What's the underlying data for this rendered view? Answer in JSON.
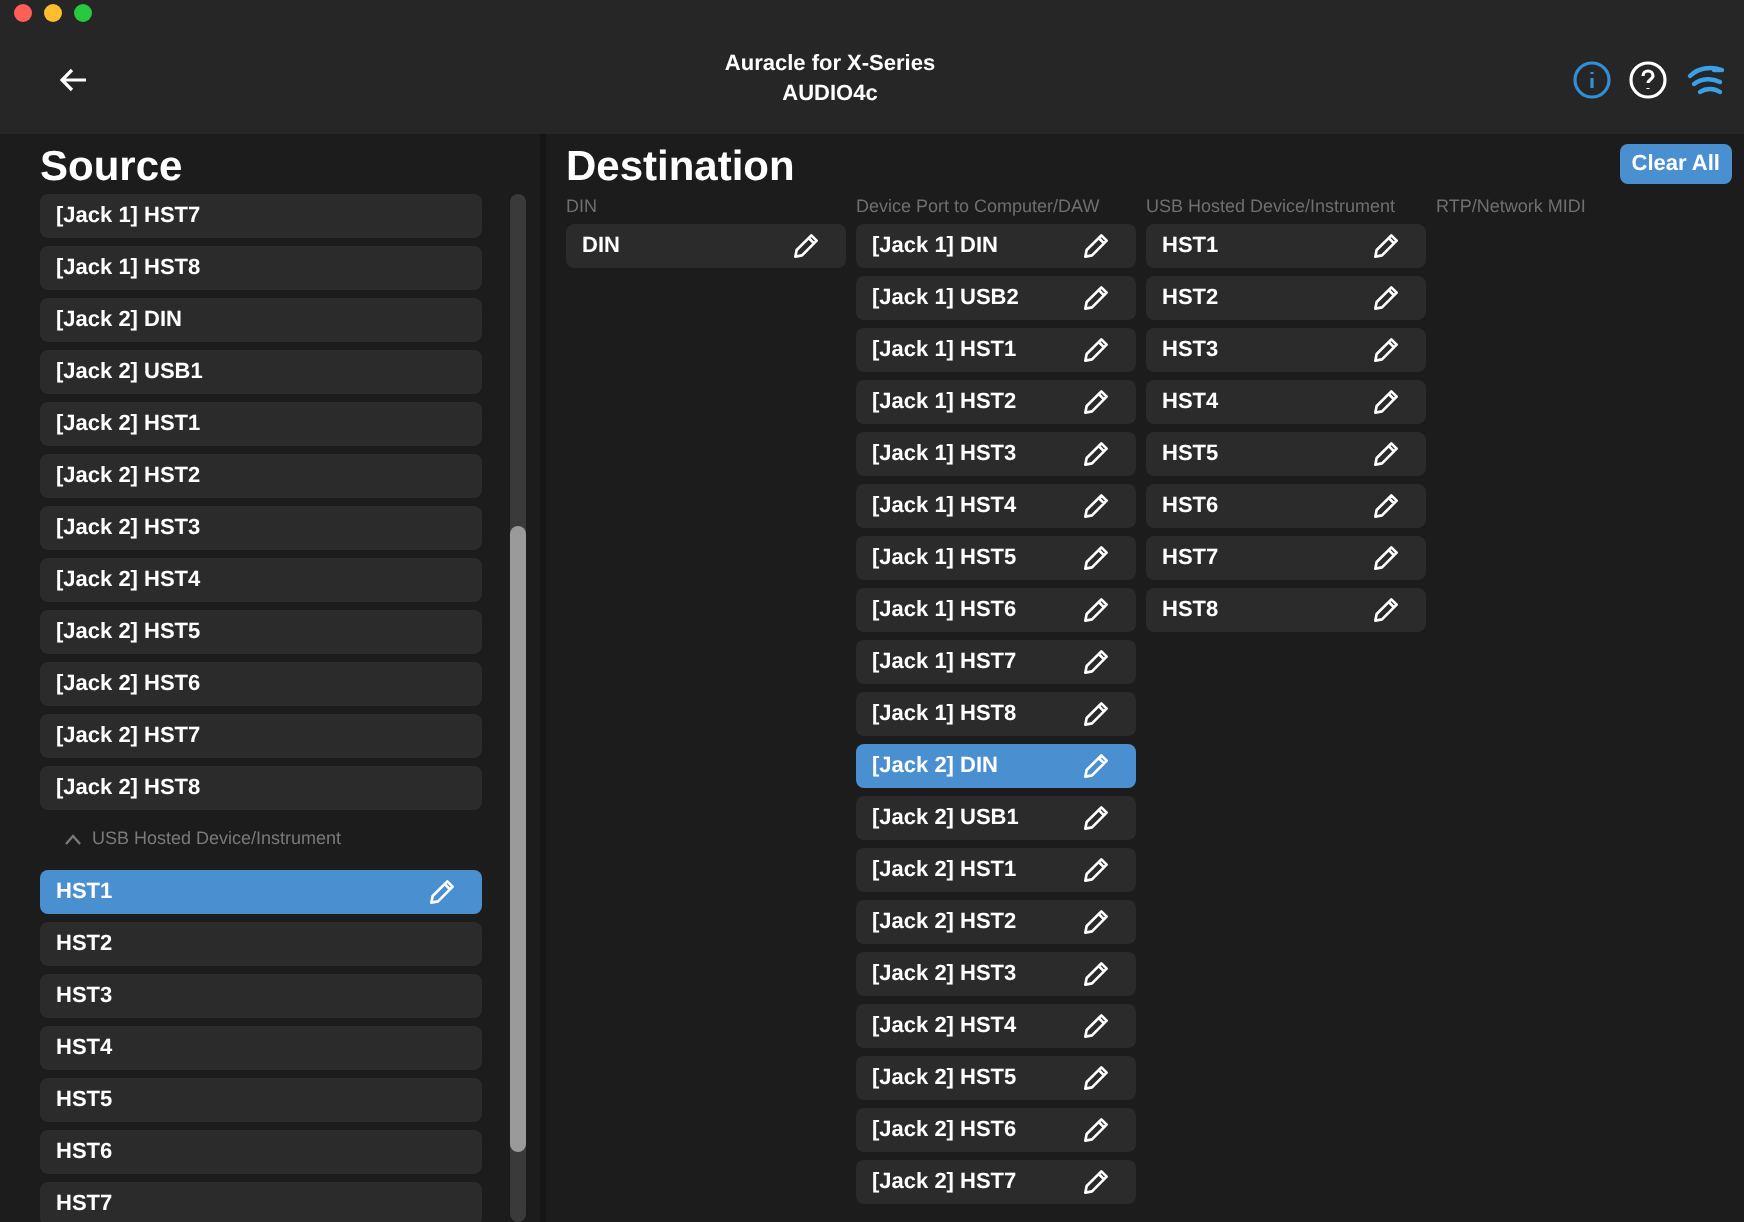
{
  "header": {
    "title": "Auracle for X-Series",
    "subtitle": "AUDIO4c"
  },
  "source": {
    "title": "Source",
    "items": [
      {
        "kind": "item",
        "label": "[Jack 1] HST7",
        "selected": false
      },
      {
        "kind": "item",
        "label": "[Jack 1] HST8",
        "selected": false
      },
      {
        "kind": "item",
        "label": "[Jack 2] DIN",
        "selected": false
      },
      {
        "kind": "item",
        "label": "[Jack 2] USB1",
        "selected": false
      },
      {
        "kind": "item",
        "label": "[Jack 2] HST1",
        "selected": false
      },
      {
        "kind": "item",
        "label": "[Jack 2] HST2",
        "selected": false
      },
      {
        "kind": "item",
        "label": "[Jack 2] HST3",
        "selected": false
      },
      {
        "kind": "item",
        "label": "[Jack 2] HST4",
        "selected": false
      },
      {
        "kind": "item",
        "label": "[Jack 2] HST5",
        "selected": false
      },
      {
        "kind": "item",
        "label": "[Jack 2] HST6",
        "selected": false
      },
      {
        "kind": "item",
        "label": "[Jack 2] HST7",
        "selected": false
      },
      {
        "kind": "item",
        "label": "[Jack 2] HST8",
        "selected": false
      },
      {
        "kind": "group",
        "label": "USB Hosted Device/Instrument",
        "expanded": true
      },
      {
        "kind": "item",
        "label": "HST1",
        "selected": true
      },
      {
        "kind": "item",
        "label": "HST2",
        "selected": false
      },
      {
        "kind": "item",
        "label": "HST3",
        "selected": false
      },
      {
        "kind": "item",
        "label": "HST4",
        "selected": false
      },
      {
        "kind": "item",
        "label": "HST5",
        "selected": false
      },
      {
        "kind": "item",
        "label": "HST6",
        "selected": false
      },
      {
        "kind": "item",
        "label": "HST7",
        "selected": false
      }
    ]
  },
  "destination": {
    "title": "Destination",
    "clear_button": "Clear All",
    "columns": [
      {
        "heading": "DIN",
        "items": [
          {
            "label": "DIN",
            "selected": false
          }
        ]
      },
      {
        "heading": "Device Port to Computer/DAW",
        "items": [
          {
            "label": "[Jack 1] DIN",
            "selected": false
          },
          {
            "label": "[Jack 1] USB2",
            "selected": false
          },
          {
            "label": "[Jack 1] HST1",
            "selected": false
          },
          {
            "label": "[Jack 1] HST2",
            "selected": false
          },
          {
            "label": "[Jack 1] HST3",
            "selected": false
          },
          {
            "label": "[Jack 1] HST4",
            "selected": false
          },
          {
            "label": "[Jack 1] HST5",
            "selected": false
          },
          {
            "label": "[Jack 1] HST6",
            "selected": false
          },
          {
            "label": "[Jack 1] HST7",
            "selected": false
          },
          {
            "label": "[Jack 1] HST8",
            "selected": false
          },
          {
            "label": "[Jack 2] DIN",
            "selected": true
          },
          {
            "label": "[Jack 2] USB1",
            "selected": false
          },
          {
            "label": "[Jack 2] HST1",
            "selected": false
          },
          {
            "label": "[Jack 2] HST2",
            "selected": false
          },
          {
            "label": "[Jack 2] HST3",
            "selected": false
          },
          {
            "label": "[Jack 2] HST4",
            "selected": false
          },
          {
            "label": "[Jack 2] HST5",
            "selected": false
          },
          {
            "label": "[Jack 2] HST6",
            "selected": false
          },
          {
            "label": "[Jack 2] HST7",
            "selected": false
          }
        ]
      },
      {
        "heading": "USB Hosted Device/Instrument",
        "items": [
          {
            "label": "HST1",
            "selected": false
          },
          {
            "label": "HST2",
            "selected": false
          },
          {
            "label": "HST3",
            "selected": false
          },
          {
            "label": "HST4",
            "selected": false
          },
          {
            "label": "HST5",
            "selected": false
          },
          {
            "label": "HST6",
            "selected": false
          },
          {
            "label": "HST7",
            "selected": false
          },
          {
            "label": "HST8",
            "selected": false
          }
        ]
      },
      {
        "heading": "RTP/Network MIDI"
      }
    ]
  }
}
